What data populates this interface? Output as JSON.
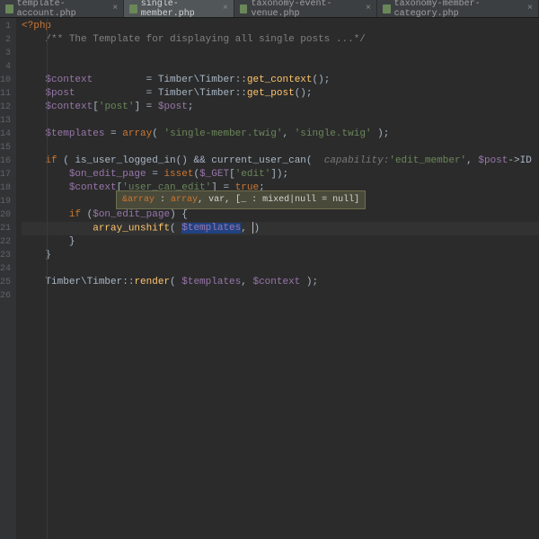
{
  "tabs": [
    {
      "label": "template-account.php",
      "close": "×"
    },
    {
      "label": "single-member.php",
      "close": "×"
    },
    {
      "label": "taxonomy-event-venue.php",
      "close": "×"
    },
    {
      "label": "taxonomy-member-category.php",
      "close": "×"
    }
  ],
  "lines": [
    "1",
    "2",
    "3",
    "4",
    "10",
    "11",
    "12",
    "13",
    "14",
    "15",
    "16",
    "17",
    "18",
    "19",
    "20",
    "21",
    "22",
    "23",
    "24",
    "25",
    "26"
  ],
  "code": {
    "l1": "<?php",
    "l2_a": "    /** ",
    "l2_b": "The Template for displaying all single posts ...",
    "l2_c": "*/",
    "l10_a": "    $context",
    "l10_b": "         = ",
    "l10_c": "Timber\\Timber",
    "l10_d": "::",
    "l10_e": "get_context",
    "l10_f": "();",
    "l11_a": "    $post",
    "l11_b": "            = ",
    "l11_c": "Timber\\Timber",
    "l11_d": "::",
    "l11_e": "get_post",
    "l11_f": "();",
    "l12_a": "    $context",
    "l12_b": "[",
    "l12_c": "'post'",
    "l12_d": "] = ",
    "l12_e": "$post",
    "l12_f": ";",
    "l14_a": "    $templates",
    "l14_b": " = ",
    "l14_c": "array",
    "l14_d": "( ",
    "l14_e": "'single-member.twig'",
    "l14_f": ", ",
    "l14_g": "'single.twig'",
    "l14_h": " );",
    "l16_a": "    if",
    "l16_b": " ( ",
    "l16_c": "is_user_logged_in",
    "l16_d": "() ",
    "l16_e": "&&",
    "l16_f": " ",
    "l16_g": "current_user_can",
    "l16_h": "(  ",
    "l16_hint": "capability:",
    "l16_i": "'edit_member'",
    "l16_j": ", ",
    "l16_k": "$post",
    "l16_l": "->",
    "l16_m": "ID",
    "l16_n": " ) ) {",
    "l17_a": "        $on_edit_page",
    "l17_b": " = ",
    "l17_c": "isset",
    "l17_d": "(",
    "l17_e": "$_GET",
    "l17_f": "[",
    "l17_g": "'edit'",
    "l17_h": "]);",
    "l18_a": "        $context",
    "l18_b": "[",
    "l18_c": "'user_can_edit'",
    "l18_d": "] = ",
    "l18_e": "true",
    "l18_f": ";",
    "l20_a": "        if",
    "l20_b": " (",
    "l20_c": "$on_edit_page",
    "l20_d": ") {",
    "l21_a": "            array_unshift",
    "l21_b": "( ",
    "l21_c": "$templates",
    "l21_d": ", ",
    "l21_e": ")",
    "l22": "        }",
    "l23": "    }",
    "l25_a": "    Timber\\Timber",
    "l25_b": "::",
    "l25_c": "render",
    "l25_d": "( ",
    "l25_e": "$templates",
    "l25_f": ", ",
    "l25_g": "$context",
    "l25_h": " );"
  },
  "tooltip": {
    "a": "&array",
    "b": " : ",
    "c": "array",
    "d": ", var, [_ : mixed|null = null]"
  }
}
